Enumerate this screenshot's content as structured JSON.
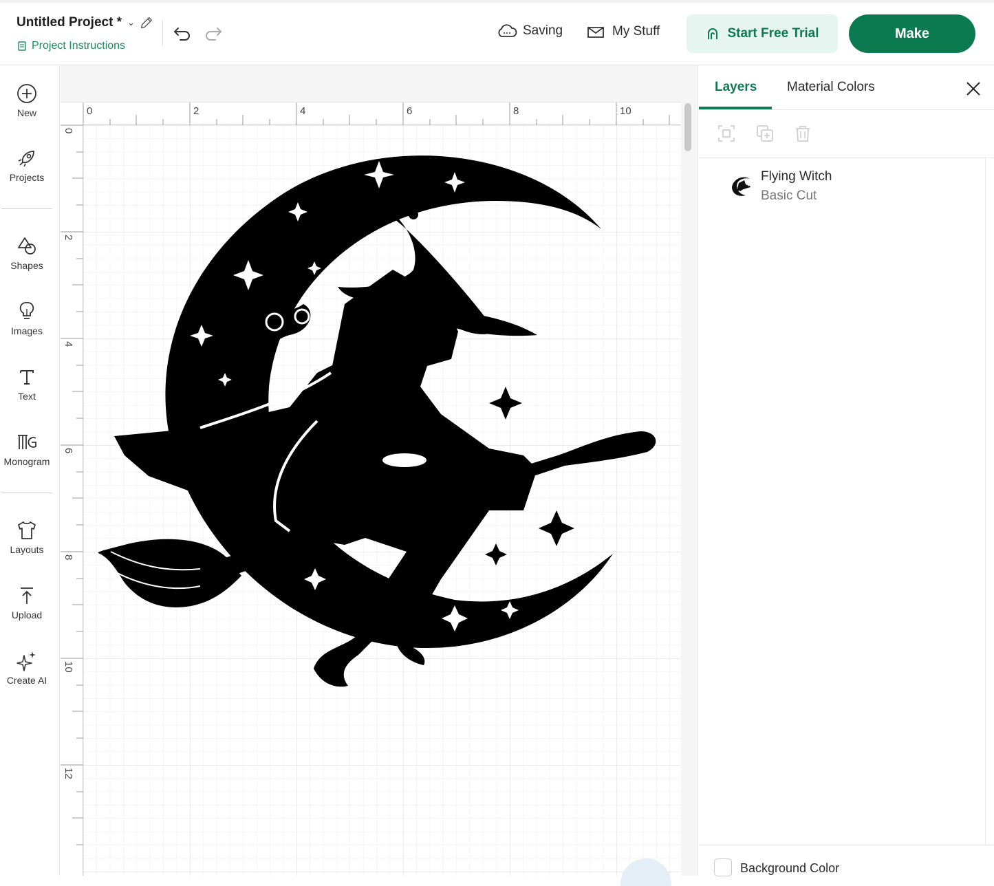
{
  "header": {
    "project_title": "Untitled Project *",
    "project_instructions": "Project Instructions",
    "saving_label": "Saving",
    "my_stuff_label": "My Stuff",
    "trial_label": "Start Free Trial",
    "make_label": "Make"
  },
  "sidebar": {
    "items": [
      {
        "label": "New",
        "icon": "plus-circle-icon"
      },
      {
        "label": "Projects",
        "icon": "rocket-icon"
      },
      {
        "label": "Shapes",
        "icon": "shapes-icon"
      },
      {
        "label": "Images",
        "icon": "lightbulb-icon"
      },
      {
        "label": "Text",
        "icon": "text-icon"
      },
      {
        "label": "Monogram",
        "icon": "monogram-icon"
      },
      {
        "label": "Layouts",
        "icon": "tshirt-icon"
      },
      {
        "label": "Upload",
        "icon": "upload-icon"
      },
      {
        "label": "Create AI",
        "icon": "sparkle-icon"
      }
    ]
  },
  "canvas": {
    "ruler_top": [
      "0",
      "2",
      "4",
      "6",
      "8",
      "10"
    ],
    "ruler_left": [
      "0",
      "2",
      "4",
      "6",
      "8",
      "10",
      "12"
    ]
  },
  "panel": {
    "tabs": [
      "Layers",
      "Material Colors"
    ],
    "layer": {
      "name": "Flying Witch",
      "operation": "Basic Cut"
    },
    "background_label": "Background Color"
  },
  "colors": {
    "accent": "#0b7a50",
    "accent_light": "#e6f5ef"
  }
}
